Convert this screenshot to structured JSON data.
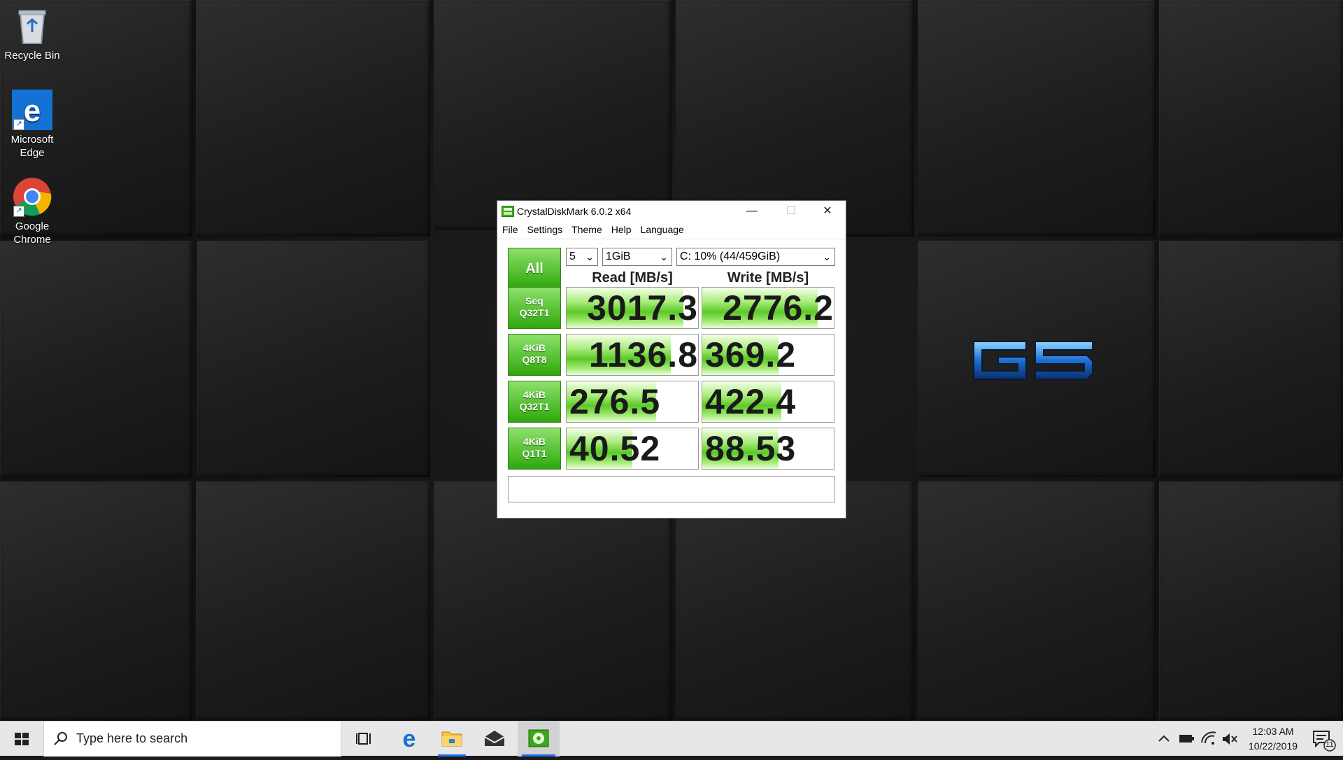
{
  "desktop": {
    "icons": [
      {
        "label": "Recycle Bin"
      },
      {
        "label": "Microsoft\nEdge"
      },
      {
        "label": "Google\nChrome"
      }
    ],
    "wallpaper_logo": "G5"
  },
  "window": {
    "title": "CrystalDiskMark 6.0.2 x64",
    "menu": [
      "File",
      "Settings",
      "Theme",
      "Help",
      "Language"
    ],
    "all_button": "All",
    "count_select": "5",
    "size_select": "1GiB",
    "drive_select": "C: 10% (44/459GiB)",
    "read_header": "Read [MB/s]",
    "write_header": "Write [MB/s]",
    "rows": [
      {
        "label_1": "Seq",
        "label_2": "Q32T1",
        "read": "3017.3",
        "write": "2776.2",
        "read_fill": 0.89,
        "write_fill": 0.88
      },
      {
        "label_1": "4KiB",
        "label_2": "Q8T8",
        "read": "1136.8",
        "write": "369.2",
        "read_fill": 0.79,
        "write_fill": 0.58
      },
      {
        "label_1": "4KiB",
        "label_2": "Q32T1",
        "read": "276.5",
        "write": "422.4",
        "read_fill": 0.68,
        "write_fill": 0.6
      },
      {
        "label_1": "4KiB",
        "label_2": "Q1T1",
        "read": "40.52",
        "write": "88.53",
        "read_fill": 0.5,
        "write_fill": 0.58
      }
    ],
    "status": ""
  },
  "taskbar": {
    "search_placeholder": "Type here to search",
    "clock_time": "12:03 AM",
    "clock_date": "10/22/2019",
    "notification_count": "11"
  },
  "colors": {
    "accent": "#1a73e8",
    "cdm_green": "#2ea80c"
  }
}
